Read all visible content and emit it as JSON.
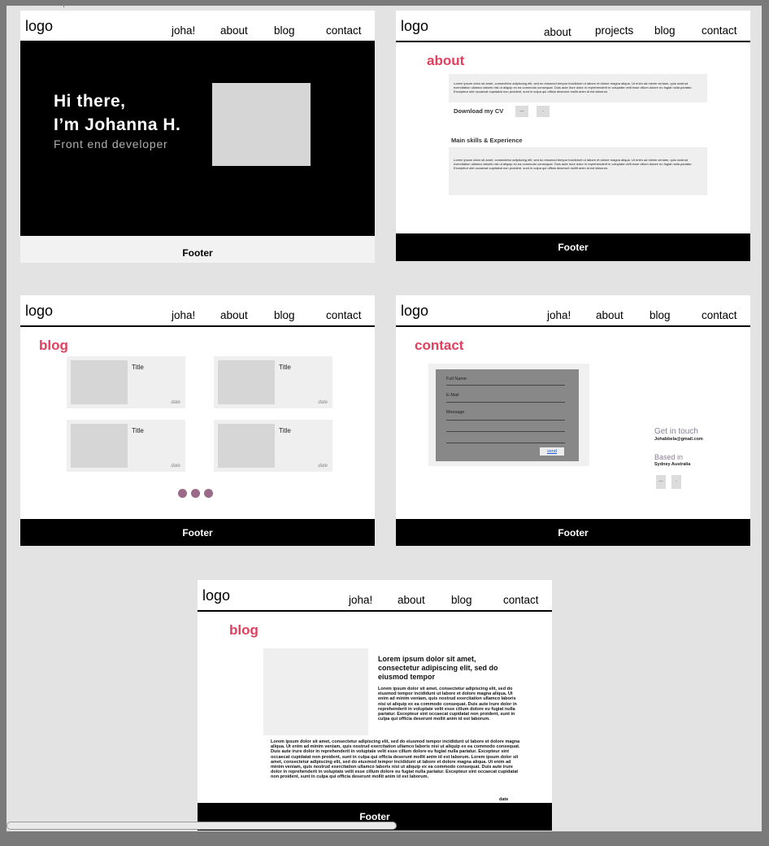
{
  "frames": {
    "home": {
      "logo": "logo",
      "nav": [
        "joha!",
        "about",
        "blog",
        "contact"
      ],
      "hero_line1": "Hi there,",
      "hero_line2": "I’m Johanna H.",
      "hero_sub": "Front end developer",
      "footer": "Footer"
    },
    "about": {
      "logo": "logo",
      "nav": [
        "about",
        "projects",
        "blog",
        "contact"
      ],
      "title": "about",
      "lorem1": "Lorem ipsum dolor sit amet, consectetur adipiscing elit, sed do eiusmod tempor incididunt ut labore et dolore magna aliqua. Ut enim ad minim veniam, quis nostrud exercitation ullamco laboris nisi ut aliquip ex ea commodo consequat. Duis aute irure dolor in reprehenderit in voluptate velit esse cillum dolore eu fugiat nulla pariatur. Excepteur sint occaecat cupidatat non proident, sunt in culpa qui officia deserunt mollit anim id est laborum.",
      "download_cv": "Download my CV",
      "skills": "Main skills & Experience",
      "lorem2": "Lorem ipsum dolor sit amet, consectetur adipiscing elit, sed do eiusmod tempor incididunt ut labore et dolore magna aliqua. Ut enim ad minim veniam, quis nostrud exercitation ullamco laboris nisi ut aliquip ex ea commodo consequat. Duis aute irure dolor in reprehenderit in voluptate velit esse cillum dolore eu fugiat nulla pariatur. Excepteur sint occaecat cupidatat non proident, sunt in culpa qui officia deserunt mollit anim id est laborum.",
      "footer": "Footer"
    },
    "blog": {
      "logo": "logo",
      "nav": [
        "joha!",
        "about",
        "blog",
        "contact"
      ],
      "title": "blog",
      "cards": [
        {
          "title": "Title",
          "date": "date"
        },
        {
          "title": "Title",
          "date": "date"
        },
        {
          "title": "Title",
          "date": "date"
        },
        {
          "title": "Title",
          "date": "date"
        }
      ],
      "footer": "Footer"
    },
    "contact": {
      "logo": "logo",
      "nav": [
        "joha!",
        "about",
        "blog",
        "contact"
      ],
      "title": "contact",
      "form_labels": [
        "Full Name",
        "E-Mail",
        "Message"
      ],
      "send": "send",
      "get_in_touch": "Get in touch",
      "email": "Johabbela@gmail.com",
      "based_in": "Based in",
      "location": "Sydney Australia",
      "footer": "Footer"
    },
    "post": {
      "logo": "logo",
      "nav": [
        "joha!",
        "about",
        "blog",
        "contact"
      ],
      "title": "blog",
      "headline": "Lorem ipsum dolor sit amet, consectetur adipiscing elit, sed do eiusmod tempor",
      "para_side": "Lorem ipsum dolor sit amet, consectetur adipiscing elit, sed do eiusmod tempor incididunt ut labore et dolore magna aliqua. Ut enim ad minim veniam, quis nostrud exercitation ullamco laboris nisi ut aliquip ex ea commodo consequat. Duis aute irure dolor in reprehenderit in voluptate velit esse cillum dolore eu fugiat nulla pariatur. Excepteur sint occaecat cupidatat non proident, sunt in culpa qui officia deserunt mollit anim id est laborum.",
      "para_full": "Lorem ipsum dolor sit amet, consectetur adipiscing elit, sed do eiusmod tempor incididunt ut labore et dolore magna aliqua. Ut enim ad minim veniam, quis nostrud exercitation ullamco laboris nisi ut aliquip ex ea commodo consequat. Duis aute irure dolor in reprehenderit in voluptate velit esse cillum dolore eu fugiat nulla pariatur. Excepteur sint occaecat cupidatat non proident, sunt in culpa qui officia deserunt mollit anim id est laborum. Lorem ipsum dolor sit amet, consectetur adipiscing elit, sed do eiusmod tempor incididunt ut labore et dolore magna aliqua. Ut enim ad minim veniam, quis nostrud exercitation ullamco laboris nisi ut aliquip ex ea commodo consequat. Duis aute irure dolor in reprehenderit in voluptate velit esse cillum dolore eu fugiat nulla pariatur. Excepteur sint occaecat cupidatat non proident, sunt in culpa qui officia deserunt mollit anim id est laborum.",
      "date": "date",
      "footer": "Footer"
    }
  },
  "colors": {
    "accent": "#e0405e",
    "dots": "#9a6a88",
    "touch": "#8a7b95"
  }
}
